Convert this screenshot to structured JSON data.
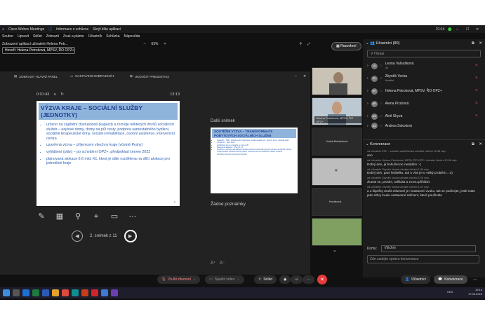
{
  "window": {
    "app_title": "Cisco Webex Meetings",
    "info_label": "Informace o schůzce",
    "hide_label": "Skrýt lištu aplikací",
    "clock_top": "21:14"
  },
  "menu": [
    "Soubor",
    "Upravit",
    "Sdílet",
    "Zobrazit",
    "Zvuk a pláme",
    "Účastník",
    "Schůzka",
    "Nápověda"
  ],
  "share": {
    "viewing_label": "Zobrazení aplikací uživatele Helena Petr...",
    "zoom": "63%",
    "presenter_chip": "Hovoří: Helena Petroková, MPSV, ŘO OPZ+"
  },
  "layout_button": "Rozvržení",
  "presentation_toolbar": {
    "panel": "ZOBRAZIT HLAVNÍ PANEL",
    "settings": "NASTAVENÍ ZOBRAZENÍ ▾",
    "end": "UKONČIT PREZENTACI"
  },
  "slide": {
    "elapsed": "0:01:43",
    "clock": "13:13",
    "title": "VÝZVA KRAJE – SOCIÁLNÍ SLUŽBY (JEDNOTKY)",
    "bullets": [
      "určeno na zajištění dostupnosti (kapacit) a rozvoje některých druhů sociálních služeb – azylové domy, domy na půl cesty, podpora samostatného bydlení, sociálně terapeutické dílny, sociální rehabilitace, osobní asistence, intervenční centra",
      "uzavřená výzva – příjemcem všechny kraje (včetně Prahy)",
      "vyhlášení (plán) – po schválení OPZ+, předpoklad červen 2022",
      "plánovaná alokace 6,6 mld. Kč, která je dále rozdělena na dílčí alokace pro jednotlivé kraje"
    ],
    "number": "2",
    "pager_label": "2. snímek z 11"
  },
  "next_slide": {
    "label": "Další snímek",
    "title": "SOUTĚŽNÍ VÝZVA – TRANSFORMACE POBYTOVÝCH SOCIÁLNÍCH SLUŽEB",
    "bullets": [
      "žadatelé – NNO, příspěvkové organizace, poskytovatelé soc. služeb, obce, městské části",
      "vyhlášení – říjen 2022",
      "průběžná výzva, uzávěrka po celou OP",
      "plánovaná alokace – 250 mil. Kč",
      "zaměření: příprava aktualizace transformačních plánů pobytových zařízení sociálních služeb; implementace transformačního plánu; podpora nových sociálních služeb a rušení transformovaných pobytových služeb"
    ]
  },
  "notes_label": "Žádné poznámky",
  "videos": [
    {
      "name": ""
    },
    {
      "name": "Helena Petroková, MPSV, ŘO OPZ+"
    },
    {
      "name": "Karla Bohačková"
    },
    {
      "name": ""
    },
    {
      "name": "Horáková"
    },
    {
      "name": ""
    }
  ],
  "participants": {
    "header": "Účastníci (80)",
    "search_placeholder": "Hledat",
    "list": [
      {
        "initials": "LV",
        "name": "Leona Valoušková",
        "sub": "Já"
      },
      {
        "initials": "ZV",
        "name": "Zbyněk Vocka",
        "sub": "Hostitel"
      },
      {
        "initials": "HP",
        "name": "Helena Petroková, MPSV, ŘO OPZ+",
        "sub": ""
      },
      {
        "initials": "AP",
        "name": "Alena Pizúrová",
        "sub": ""
      },
      {
        "initials": "AS",
        "name": "Aleš Skyva",
        "sub": ""
      },
      {
        "initials": "AS",
        "name": "Andrea Sokolová",
        "sub": ""
      }
    ]
  },
  "chat": {
    "header": "Konverzace",
    "messages": [
      {
        "meta": "od uživatele ESF – sociální začleňování uživatel všichni 12:08 odp.",
        "text": "ano"
      },
      {
        "meta": "od uživatele Helena Petroková, MPSV, ŘO OPZ+ uživatel všichni 12:08 odp.",
        "text": "Dobrý den, já bohužel nic neslyším :-("
      },
      {
        "meta": "od uživatele Zbyněk Vocka uživatel všichni 1:00 odp.",
        "text": "Dobrý den, paní ředitelko, tak u Vás je to velký problém...:o)"
      },
      {
        "meta": "od uživatele Zbyněk Vocka uživatel všichni 1:00 odp.",
        "text": "zkuste se, prosím, odhlásit a znovu přihlásit"
      },
      {
        "meta": "od uživatele Zbyněk Vocka uživatel všichni 1:01 odp.",
        "text": "a u šipečky Zrušit ztlumení je i nastavení zvuku, tak se podívejte, jestli máte jako zdroj zvuku nastavené zařízení, které používáte"
      }
    ],
    "to_label": "Komu:",
    "to_value": "Všichni",
    "input_placeholder": "Zde zadejte zprávu konverzace"
  },
  "bottom": {
    "unmute": "Zrušit ztlumení",
    "video": "Spustit video",
    "share": "Sdílet",
    "participants": "Účastníci",
    "chat": "Konverzace"
  },
  "taskbar": {
    "time": "19:13",
    "date": "17.05.2022",
    "lang": "CES"
  },
  "colors": {
    "end_call": "#e23b3b",
    "slide_title_bg": "#8fb4dc"
  }
}
